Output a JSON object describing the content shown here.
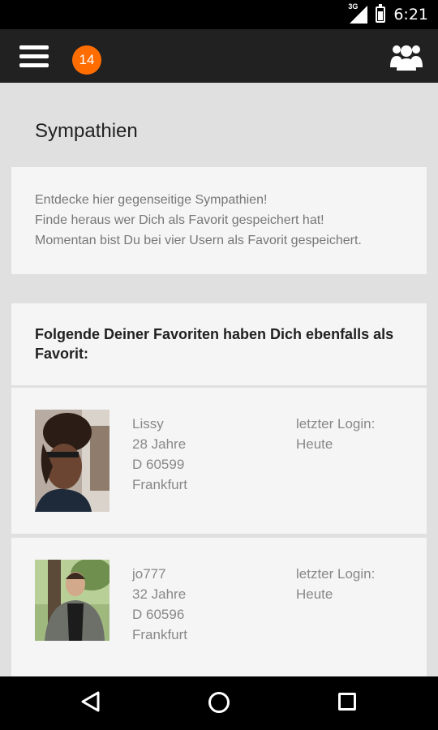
{
  "status_bar": {
    "network_label": "3G",
    "time": "6:21"
  },
  "app_bar": {
    "notification_count": "14",
    "left_icon": "hamburger-menu-icon",
    "right_icon": "users-group-icon"
  },
  "page": {
    "title": "Sympathien"
  },
  "intro": {
    "lines": [
      "Entdecke hier gegenseitige Sympathien!",
      "Finde heraus wer Dich als Favorit gespeichert hat!",
      "Momentan bist Du bei vier Usern als Favorit gespeichert."
    ]
  },
  "favorites": {
    "heading": "Folgende Deiner Favoriten haben Dich ebenfalls als Favorit:",
    "users": [
      {
        "name": "Lissy",
        "age": "28 Jahre",
        "zip": "D 60599",
        "city": "Frankfurt",
        "login_label": "letzter Login:",
        "login_value": "Heute"
      },
      {
        "name": "jo777",
        "age": "32 Jahre",
        "zip": "D 60596",
        "city": "Frankfurt",
        "login_label": "letzter Login:",
        "login_value": "Heute"
      }
    ]
  },
  "colors": {
    "accent": "#ff6d00",
    "app_bar": "#212121",
    "background": "#e0e0e0",
    "card": "#f5f5f5"
  }
}
